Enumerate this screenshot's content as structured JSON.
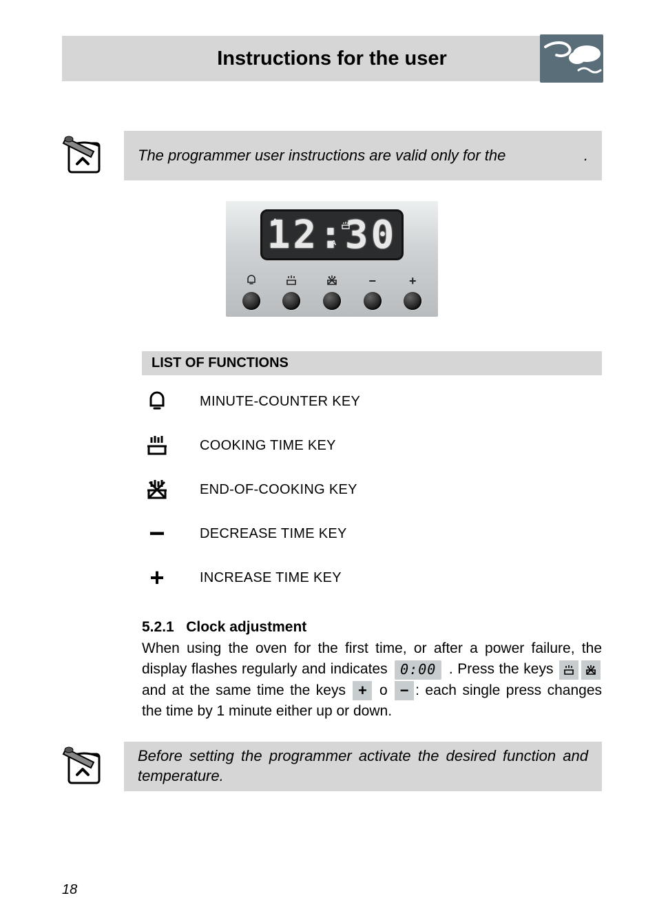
{
  "header": {
    "title": "Instructions for the user"
  },
  "top_note": {
    "text": "The programmer user instructions are valid only for the",
    "trailing_period": "."
  },
  "programmer": {
    "display_time": "12:30",
    "display_indicator_A": "A",
    "buttons": [
      {
        "glyph": "bell",
        "name": "minute-counter-button"
      },
      {
        "glyph": "pot",
        "name": "cooking-time-button"
      },
      {
        "glyph": "potx",
        "name": "end-of-cooking-button"
      },
      {
        "glyph": "minus",
        "name": "decrease-button"
      },
      {
        "glyph": "plus",
        "name": "increase-button"
      }
    ]
  },
  "functions": {
    "heading": "LIST OF FUNCTIONS",
    "items": [
      {
        "icon": "bell",
        "label": "MINUTE-COUNTER KEY"
      },
      {
        "icon": "pot",
        "label": "COOKING TIME KEY"
      },
      {
        "icon": "potx",
        "label": "END-OF-COOKING KEY"
      },
      {
        "icon": "minus",
        "label": "DECREASE TIME KEY"
      },
      {
        "icon": "plus",
        "label": "INCREASE TIME KEY"
      }
    ]
  },
  "clock": {
    "heading_num": "5.2.1",
    "heading_text": "Clock adjustment",
    "sentence_1a": "When using the oven for the first time, or after a power failure, the display flashes regularly and indicates",
    "chip1_text": "0:00",
    "sentence_1b": ". Press the keys",
    "sentence_1c": "and at the same time the keys",
    "connector_o": "o",
    "sentence_1d": ": each single press changes the time by 1 minute either up or down."
  },
  "bottom_note": {
    "text": "Before setting the programmer activate the desired function and temperature."
  },
  "page_number": "18"
}
